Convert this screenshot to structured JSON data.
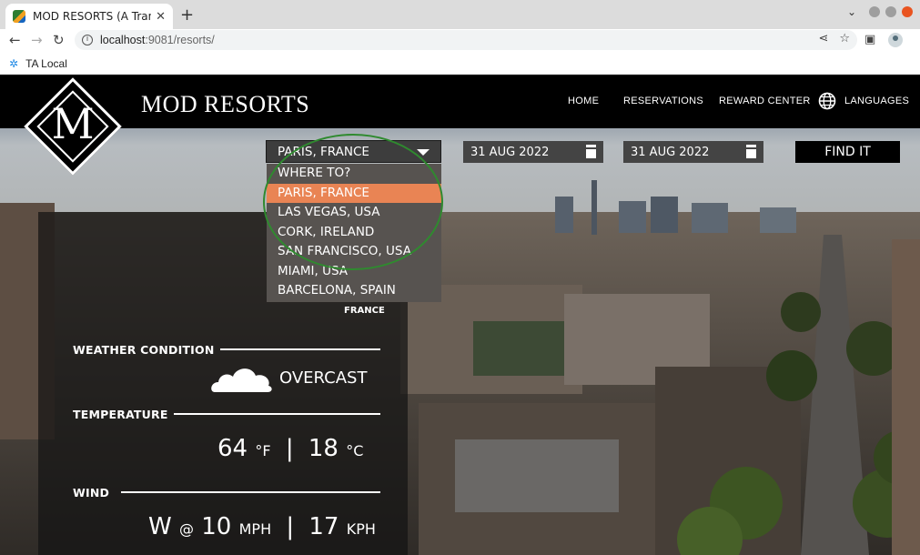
{
  "browser": {
    "tab_title": "MOD RESORTS (A Transfo",
    "tab_close": "✕",
    "new_tab": "+",
    "url_host": "localhost",
    "url_rest": ":9081/resorts/",
    "bookmark_label": "TA Local"
  },
  "header": {
    "logo_letter": "M",
    "brand": "MOD RESORTS",
    "nav": [
      "HOME",
      "RESERVATIONS",
      "REWARD CENTER",
      "LANGUAGES"
    ]
  },
  "search": {
    "destination_value": "PARIS, FRANCE",
    "check_in": "31 AUG 2022",
    "check_out": "31 AUG 2022",
    "find_label": "FIND IT"
  },
  "dropdown": {
    "options": [
      "WHERE TO?",
      "PARIS, FRANCE",
      "LAS VEGAS, USA",
      "CORK, IRELAND",
      "SAN FRANCISCO, USA",
      "MIAMI, USA",
      "BARCELONA, SPAIN"
    ],
    "selected": "PARIS, FRANCE"
  },
  "weather": {
    "country": "FRANCE",
    "condition_label": "WEATHER CONDITION",
    "condition_value": "OVERCAST",
    "temperature_label": "TEMPERATURE",
    "temp_f": "64",
    "temp_f_unit": "°F",
    "temp_sep": "|",
    "temp_c": "18",
    "temp_c_unit": "°C",
    "wind_label": "WIND",
    "wind_dir": "W",
    "wind_at": "@",
    "wind_mph": "10",
    "wind_mph_unit": "MPH",
    "wind_sep": "|",
    "wind_kph": "17",
    "wind_kph_unit": "KPH"
  },
  "colors": {
    "accent_selected": "#e98454",
    "highlight_ring": "#2f8a2f"
  }
}
